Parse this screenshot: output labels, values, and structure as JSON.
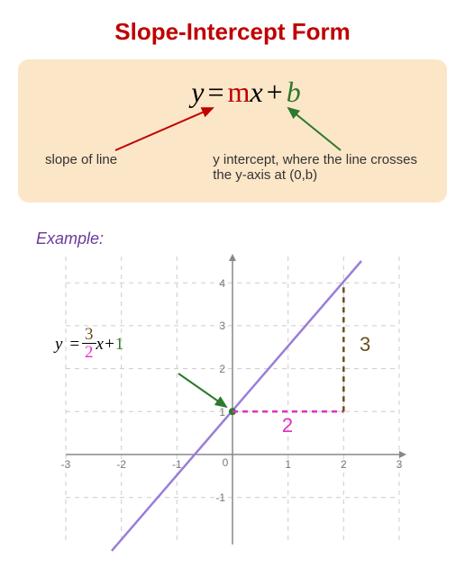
{
  "title": "Slope-Intercept Form",
  "formula": {
    "y": "y",
    "eq": "=",
    "m": "m",
    "x": "x",
    "plus": "+",
    "b": "b"
  },
  "annotations": {
    "slope_label": "slope of line",
    "intercept_label": "y intercept, where the line crosses the y-axis at (0,b)"
  },
  "example": {
    "label": "Example:",
    "equation": {
      "lhs": "y",
      "eq": "=",
      "num": "3",
      "den": "2",
      "var": "x",
      "plus": "+",
      "const": "1"
    },
    "rise_label": "3",
    "run_label": "2"
  },
  "chart_data": {
    "type": "line",
    "title": "",
    "xlabel": "",
    "ylabel": "",
    "xlim": [
      -3,
      3
    ],
    "ylim": [
      -2,
      4.5
    ],
    "xticks": [
      -3,
      -2,
      -1,
      0,
      1,
      2,
      3
    ],
    "yticks": [
      -1,
      0,
      1,
      2,
      3,
      4
    ],
    "line": {
      "slope": 1.5,
      "intercept": 1,
      "points": [
        [
          -2,
          -2
        ],
        [
          0,
          1
        ],
        [
          2,
          4
        ]
      ]
    },
    "y_intercept_point": [
      0,
      1
    ],
    "rise": 3,
    "run": 2,
    "run_segment": {
      "from": [
        0,
        1
      ],
      "to": [
        2,
        1
      ],
      "color": "#e030c0"
    },
    "rise_segment": {
      "from": [
        2,
        1
      ],
      "to": [
        2,
        4
      ],
      "color": "#6b5020"
    }
  }
}
